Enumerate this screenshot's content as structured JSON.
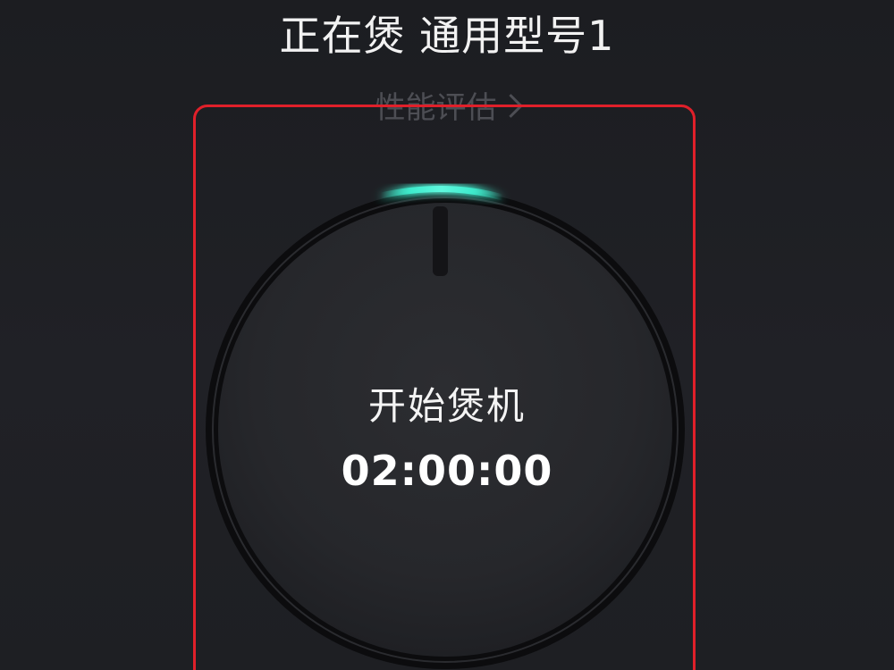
{
  "header": {
    "title": "正在煲 通用型号1"
  },
  "eval_link": {
    "label": "性能评估"
  },
  "dial": {
    "label": "开始煲机",
    "timer": "02:00:00",
    "indicator_color": "#3ff0d0",
    "frame_color": "#e0202a"
  },
  "icons": {
    "eval_link_icon": "chevron-right-icon"
  }
}
